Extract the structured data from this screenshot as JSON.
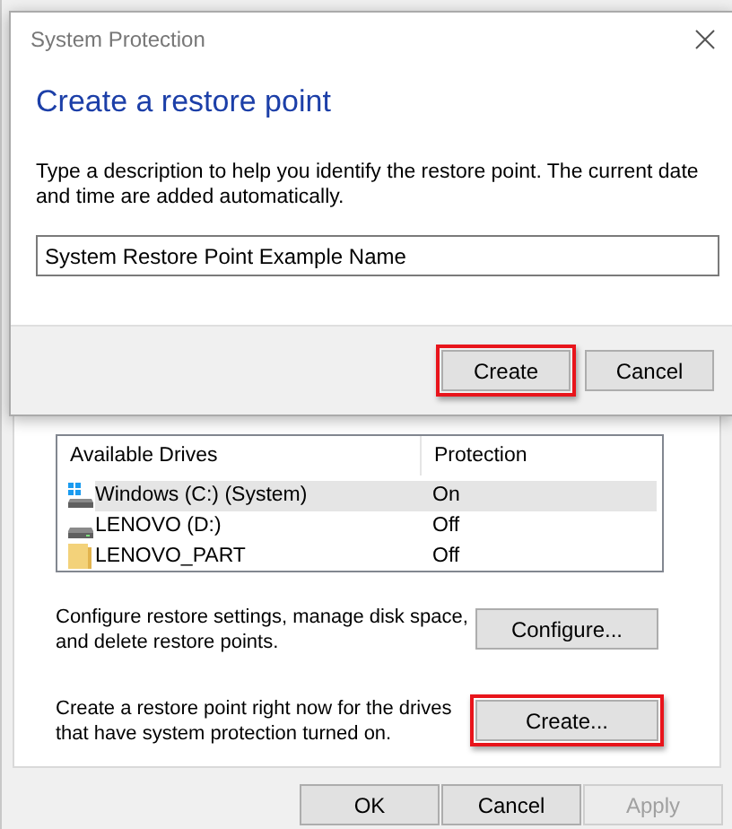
{
  "dialog": {
    "title": "System Protection",
    "heading": "Create a restore point",
    "description": "Type a description to help you identify the restore point. The current date and time are added automatically.",
    "input": {
      "value": "System Restore Point Example Name"
    },
    "buttons": [
      {
        "label": "Create",
        "highlighted": true
      },
      {
        "label": "Cancel",
        "highlighted": false
      }
    ]
  },
  "drives": {
    "columns": [
      "Available Drives",
      "Protection"
    ],
    "rows": [
      {
        "name": "Windows (C:) (System)",
        "kind": "system",
        "protection": "On",
        "selected": true
      },
      {
        "name": "LENOVO (D:)",
        "kind": "drive",
        "protection": "Off",
        "selected": false
      },
      {
        "name": "LENOVO_PART",
        "kind": "folder",
        "protection": "Off",
        "selected": false
      }
    ]
  },
  "configure": {
    "description": "Configure restore settings, manage disk space, and delete restore points.",
    "button": {
      "label": "Configure...",
      "highlighted": false
    }
  },
  "create": {
    "description": "Create a restore point right now for the drives that have system protection turned on.",
    "button": {
      "label": "Create...",
      "highlighted": true
    }
  },
  "buttons": [
    {
      "label": "OK",
      "disabled": false
    },
    {
      "label": "Cancel",
      "disabled": false
    },
    {
      "label": "Apply",
      "disabled": true
    }
  ]
}
